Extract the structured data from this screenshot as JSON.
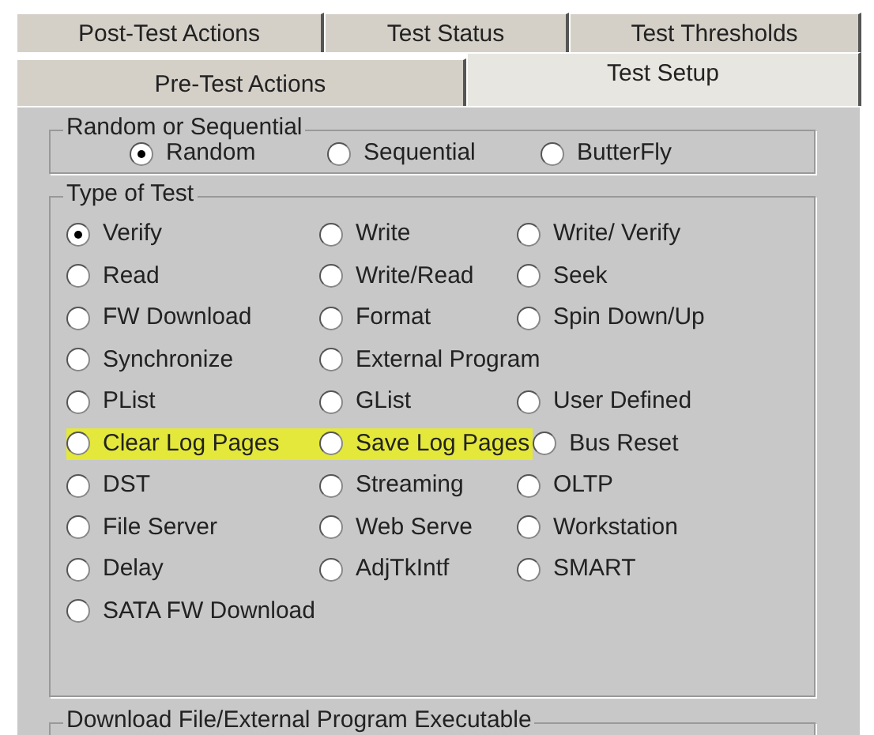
{
  "tab_rows": [
    [
      {
        "label": "Post-Test Actions",
        "selected": false
      },
      {
        "label": "Test Status",
        "selected": false
      },
      {
        "label": "Test Thresholds",
        "selected": false
      }
    ],
    [
      {
        "label": "Pre-Test Actions",
        "selected": false
      },
      {
        "label": "Test Setup",
        "selected": true
      }
    ]
  ],
  "random_or_sequential": {
    "title": "Random or Sequential",
    "options": [
      {
        "label": "Random",
        "selected": true
      },
      {
        "label": "Sequential",
        "selected": false
      },
      {
        "label": "ButterFly",
        "selected": false
      }
    ]
  },
  "type_of_test": {
    "title": "Type of Test",
    "rows": [
      [
        {
          "label": "Verify",
          "selected": true,
          "highlighted": false
        },
        {
          "label": "Write",
          "selected": false,
          "highlighted": false
        },
        {
          "label": "Write/ Verify",
          "selected": false,
          "highlighted": false
        }
      ],
      [
        {
          "label": "Read",
          "selected": false,
          "highlighted": false
        },
        {
          "label": "Write/Read",
          "selected": false,
          "highlighted": false
        },
        {
          "label": "Seek",
          "selected": false,
          "highlighted": false
        }
      ],
      [
        {
          "label": "FW Download",
          "selected": false,
          "highlighted": false
        },
        {
          "label": "Format",
          "selected": false,
          "highlighted": false
        },
        {
          "label": "Spin Down/Up",
          "selected": false,
          "highlighted": false
        }
      ],
      [
        {
          "label": "Synchronize",
          "selected": false,
          "highlighted": false
        },
        {
          "label": "External Program",
          "selected": false,
          "highlighted": false
        }
      ],
      [
        {
          "label": "PList",
          "selected": false,
          "highlighted": false
        },
        {
          "label": "GList",
          "selected": false,
          "highlighted": false
        },
        {
          "label": "User Defined",
          "selected": false,
          "highlighted": false
        }
      ],
      [
        {
          "label": "Clear Log Pages",
          "selected": false,
          "highlighted": true
        },
        {
          "label": "Save Log Pages",
          "selected": false,
          "highlighted": true
        },
        {
          "label": "Bus Reset",
          "selected": false,
          "highlighted": false
        }
      ],
      [
        {
          "label": "DST",
          "selected": false,
          "highlighted": false
        },
        {
          "label": "Streaming",
          "selected": false,
          "highlighted": false
        },
        {
          "label": "OLTP",
          "selected": false,
          "highlighted": false
        }
      ],
      [
        {
          "label": "File Server",
          "selected": false,
          "highlighted": false
        },
        {
          "label": "Web Serve",
          "selected": false,
          "highlighted": false
        },
        {
          "label": "Workstation",
          "selected": false,
          "highlighted": false
        }
      ],
      [
        {
          "label": "Delay",
          "selected": false,
          "highlighted": false
        },
        {
          "label": "AdjTkIntf",
          "selected": false,
          "highlighted": false
        },
        {
          "label": "SMART",
          "selected": false,
          "highlighted": false
        }
      ],
      [
        {
          "label": "SATA FW Download",
          "selected": false,
          "highlighted": false
        }
      ]
    ]
  },
  "download_group": {
    "title": "Download File/External Program Executable"
  }
}
